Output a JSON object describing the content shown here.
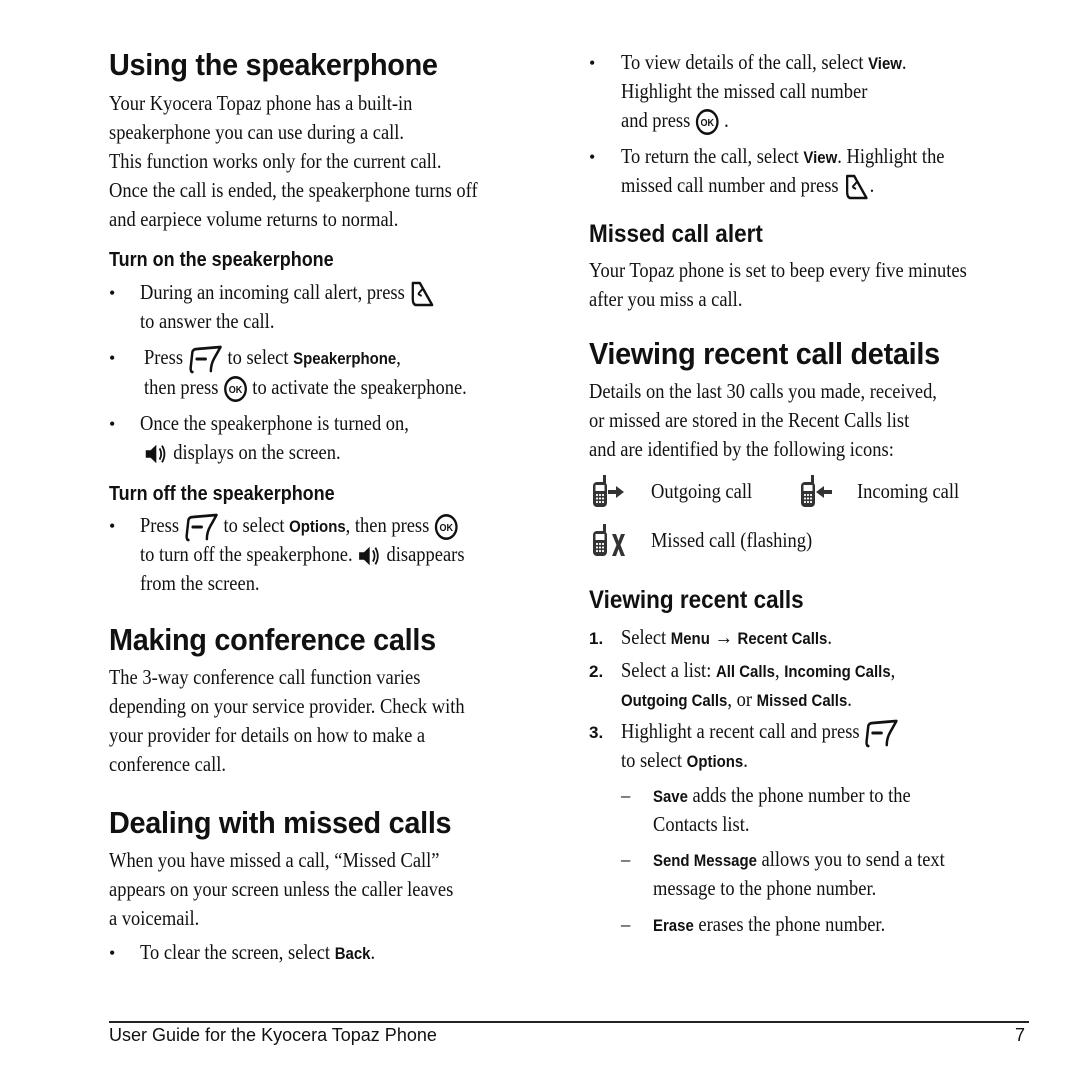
{
  "left": {
    "speakerphone": {
      "title": "Using the speakerphone",
      "intro": [
        "Your Kyocera Topaz phone has a built-in",
        "speakerphone you can use during a call.",
        "This function works only for the current call.",
        "Once the call is ended, the speakerphone turns off",
        "and earpiece volume returns to normal."
      ],
      "turn_on": {
        "heading": "Turn on the speakerphone",
        "b1_l1": "During an incoming call alert, press",
        "b1_l2": "to answer the call.",
        "b2_press": "Press",
        "b2_select": "to select",
        "b2_option": "Speakerphone",
        "b2_comma": ",",
        "b2_then": "then press",
        "b2_rest": "to activate the speakerphone.",
        "b3_l1": "Once the speakerphone is turned on,",
        "b3_l2": "displays on the screen."
      },
      "turn_off": {
        "heading": "Turn off the speakerphone",
        "press": "Press",
        "select": "to select",
        "option": "Options",
        "then": ", then press",
        "l2a": "to turn off the speakerphone.",
        "l2b": "disappears",
        "l3": "from the screen."
      }
    },
    "conference": {
      "title": "Making conference calls",
      "body": [
        "The 3-way conference call function varies",
        "depending on your service provider. Check with",
        "your provider for details on how to make a",
        "conference call."
      ]
    },
    "missed": {
      "title": "Dealing with missed calls",
      "body": [
        "When you have missed a call, “Missed Call”",
        "appears on your screen unless the caller leaves",
        "a voicemail."
      ],
      "bullet_text": "To clear the screen, select",
      "bullet_option": "Back",
      "bullet_end": "."
    }
  },
  "right": {
    "view_bullets": {
      "b1_l1": "To view details of the call, select",
      "b1_opt": "View",
      "b1_l2": "Highlight the missed call number",
      "b1_l3": "and press",
      "b2_l1a": "To return the call, select",
      "b2_opt": "View",
      "b2_l1b": ". Highlight the",
      "b2_l2": "missed call number and press",
      "period": "."
    },
    "missed_alert": {
      "heading": "Missed call alert",
      "body": [
        "Your Topaz phone is set to beep every five minutes",
        "after you miss a call."
      ]
    },
    "recent_details": {
      "title": "Viewing recent call details",
      "body": [
        "Details on the last 30 calls you made, received,",
        "or missed are stored in the Recent Calls list",
        "and are identified by the following icons:"
      ],
      "icons": [
        {
          "icon": "outgoing-call-icon",
          "label": "Outgoing call"
        },
        {
          "icon": "incoming-call-icon",
          "label": "Incoming call"
        },
        {
          "icon": "missed-call-icon",
          "label": "Missed call (flashing)"
        }
      ]
    },
    "recent_calls": {
      "heading": "Viewing recent calls",
      "steps": {
        "n1": "1.",
        "n2": "2.",
        "n3": "3.",
        "s1_a": "Select",
        "s1_menu": "Menu",
        "s1_arrow": "→",
        "s1_recent": "Recent Calls",
        "s1_end": ".",
        "s2_a": "Select a list:",
        "s2_all": "All Calls",
        "s2_in": "Incoming Calls",
        "s2_out": "Outgoing Calls",
        "s2_or": ", or",
        "s2_missed": "Missed Calls",
        "s2_end": ".",
        "s3_a": "Highlight a recent call and press",
        "s3_b": "to select",
        "s3_opt": "Options",
        "s3_end": "."
      },
      "options": [
        {
          "name": "Save",
          "text": "adds the phone number to the",
          "text2": "Contacts list."
        },
        {
          "name": "Send Message",
          "text": "allows you to send a text",
          "text2": "message to the phone number."
        },
        {
          "name": "Erase",
          "text": "erases the phone number.",
          "text2": ""
        }
      ],
      "dash": "–"
    }
  },
  "footer": {
    "title": "User Guide for the Kyocera Topaz Phone",
    "page": "7"
  }
}
